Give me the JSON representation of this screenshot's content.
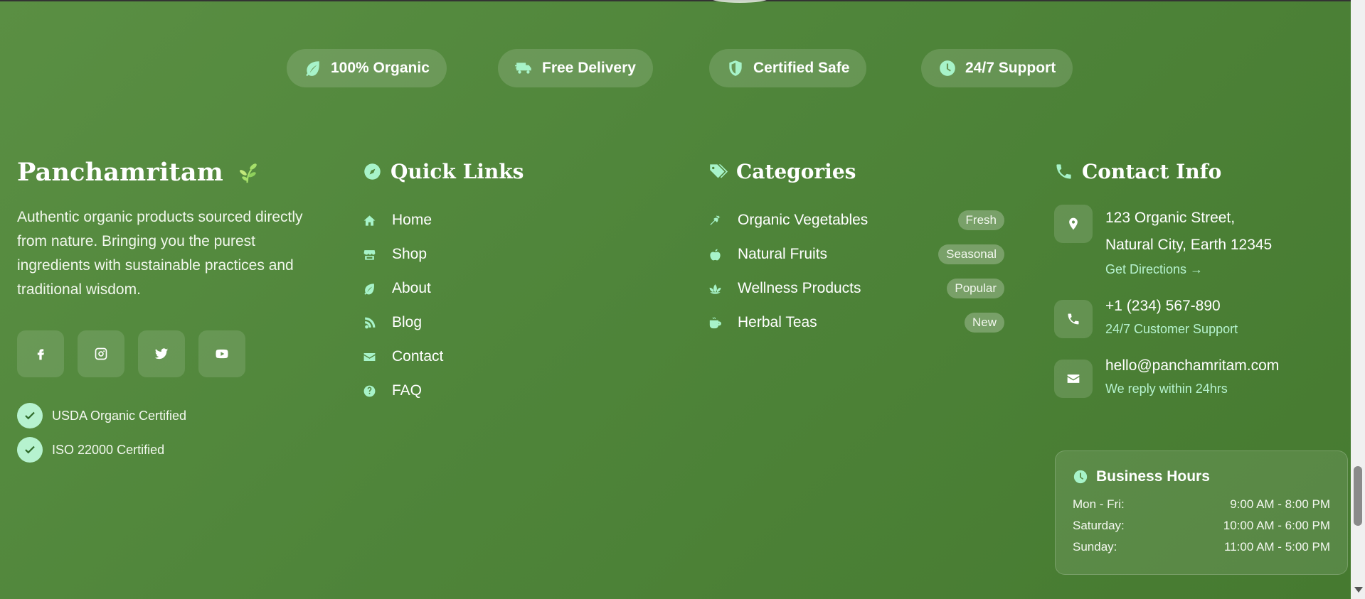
{
  "features": [
    {
      "label": "100% Organic",
      "icon": "leaf-icon"
    },
    {
      "label": "Free Delivery",
      "icon": "truck-icon"
    },
    {
      "label": "Certified Safe",
      "icon": "shield-icon"
    },
    {
      "label": "24/7 Support",
      "icon": "clock-icon"
    }
  ],
  "brand": {
    "name": "Panchamritam",
    "description": "Authentic organic products sourced directly from nature. Bringing you the purest ingredients with sustainable practices and traditional wisdom.",
    "socials": [
      "facebook-icon",
      "instagram-icon",
      "twitter-icon",
      "youtube-icon"
    ],
    "certifications": [
      "USDA Organic Certified",
      "ISO 22000 Certified"
    ]
  },
  "quick_links": {
    "title": "Quick Links",
    "items": [
      {
        "label": "Home",
        "icon": "home-icon"
      },
      {
        "label": "Shop",
        "icon": "store-icon"
      },
      {
        "label": "About",
        "icon": "leaf-icon"
      },
      {
        "label": "Blog",
        "icon": "blog-icon"
      },
      {
        "label": "Contact",
        "icon": "envelope-icon"
      },
      {
        "label": "FAQ",
        "icon": "question-icon"
      }
    ]
  },
  "categories": {
    "title": "Categories",
    "items": [
      {
        "label": "Organic Vegetables",
        "badge": "Fresh",
        "icon": "carrot-icon"
      },
      {
        "label": "Natural Fruits",
        "badge": "Seasonal",
        "icon": "apple-icon"
      },
      {
        "label": "Wellness Products",
        "badge": "Popular",
        "icon": "lotus-icon"
      },
      {
        "label": "Herbal Teas",
        "badge": "New",
        "icon": "mug-icon"
      }
    ]
  },
  "contact": {
    "title": "Contact Info",
    "address_line1": "123 Organic Street,",
    "address_line2": "Natural City, Earth 12345",
    "directions": "Get Directions →",
    "phone": "+1 (234) 567-890",
    "phone_sub": "24/7 Customer Support",
    "email": "hello@panchamritam.com",
    "email_sub": "We reply within 24hrs"
  },
  "hours": {
    "title": "Business Hours",
    "rows": [
      {
        "day": "Mon - Fri:",
        "time": "9:00 AM - 8:00 PM"
      },
      {
        "day": "Saturday:",
        "time": "10:00 AM - 6:00 PM"
      },
      {
        "day": "Sunday:",
        "time": "11:00 AM - 5:00 PM"
      }
    ]
  },
  "colors": {
    "background": "#5a8f43",
    "accent": "#a7f3c9"
  }
}
